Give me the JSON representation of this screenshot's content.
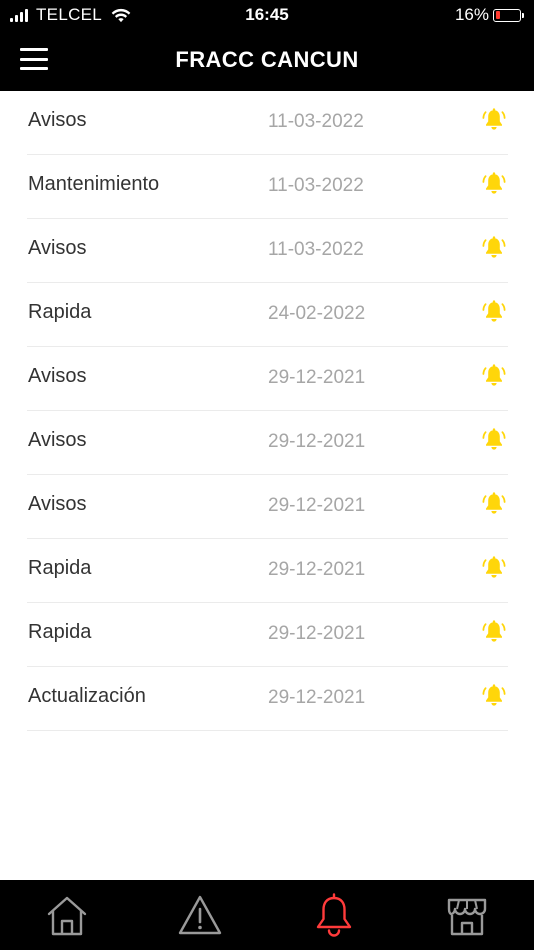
{
  "status_bar": {
    "carrier": "TELCEL",
    "time": "16:45",
    "battery_percent": "16%",
    "battery_level": 0.16
  },
  "header": {
    "title": "FRACC CANCUN"
  },
  "notifications": [
    {
      "title": "Avisos",
      "date": "11-03-2022"
    },
    {
      "title": "Mantenimiento",
      "date": "11-03-2022"
    },
    {
      "title": "Avisos",
      "date": "11-03-2022"
    },
    {
      "title": "Rapida",
      "date": "24-02-2022"
    },
    {
      "title": "Avisos",
      "date": "29-12-2021"
    },
    {
      "title": "Avisos",
      "date": "29-12-2021"
    },
    {
      "title": "Avisos",
      "date": "29-12-2021"
    },
    {
      "title": "Rapida",
      "date": "29-12-2021"
    },
    {
      "title": "Rapida",
      "date": "29-12-2021"
    },
    {
      "title": "Actualización",
      "date": "29-12-2021"
    }
  ],
  "icons": {
    "menu": "hamburger-icon",
    "row": "bell-ringing-icon",
    "nav_home": "home-icon",
    "nav_alerts": "warning-triangle-icon",
    "nav_notifications": "bell-icon",
    "nav_store": "storefront-icon"
  },
  "colors": {
    "bar_background": "#000000",
    "bell_yellow": "#ffd60a",
    "active_tab": "#ff3b3b",
    "inactive_tab": "#9a9a9a",
    "title_text": "#333333",
    "date_text": "#a6a6a6",
    "battery_low": "#ff3b30"
  },
  "bottom_nav": {
    "active": "notifications"
  }
}
